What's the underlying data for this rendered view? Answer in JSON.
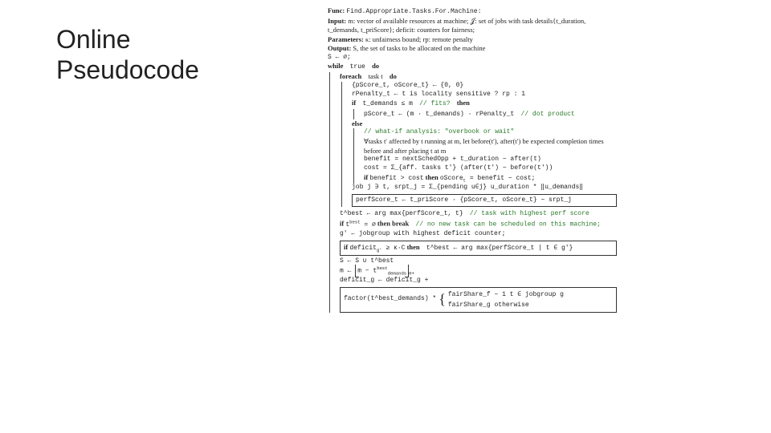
{
  "title_line1": "Online",
  "title_line2": "Pseudocode",
  "algo": {
    "func_label": "Func:",
    "func_name": "Find.Appropriate.Tasks.For.Machine:",
    "input_label": "Input:",
    "input_text": "m: vector of available resources at machine; 𝒥: set of jobs with task details{t_duration, t_demands, t_priScore}; deficit: counters for fairness;",
    "params_label": "Parameters:",
    "params_text": "κ: unfairness bound; rp: remote penalty",
    "output_label": "Output:",
    "output_text": "S, the set of tasks to be allocated on the machine",
    "l_init": "S ← ∅;",
    "l_while": "while",
    "l_while_cond": "true",
    "l_while_do": "do",
    "l_foreach": "foreach",
    "l_foreach_cond": "task t",
    "l_foreach_do": "do",
    "l_scores_init": "{pScore_t, oScore_t} ← {0, 0}",
    "l_rpenalty": "rPenalty_t ← t is locality sensitive ? rp : 1",
    "l_if": "if",
    "l_if_cond": "t_demands ≤ m",
    "l_if_comment": "// fits?",
    "l_then": "then",
    "l_pscore": "pScore_t ← (m · t_demands) · rPenalty_t",
    "l_pscore_comment": "// dot product",
    "l_else": "else",
    "l_else_comment": "// what-if analysis: \"overbook or wait\"",
    "l_forall_tasks": "∀tasks t′ affected by t running at m, let before(t′), after(t′) be expected completion times before and after placing t at m",
    "l_benefit": "benefit = nextSchedOpp + t_duration − after(t)",
    "l_cost": "cost = Σ_{aff. tasks t′} (after(t′) − before(t′))",
    "l_if_benefit": "if benefit > cost then oScore_t = benefit − cost;",
    "l_job_srpt": "job j ∋ t, srpt_j = Σ_{pending u∈j} u_duration * ‖u_demands‖",
    "l_perfscore": "perfScore_t ← t_priScore · {pScore_t, oScore_t} − srpt_j",
    "l_tbest": "t^best ← arg max{perfScore_t, t}",
    "l_tbest_comment": "// task with highest perf score",
    "l_if_empty": "if t^best = ∅ then break",
    "l_if_empty_comment": "// no new task can be scheduled on this machine;",
    "l_gprime": "g′ ← jobgroup with highest deficit counter;",
    "l_if_def_cond": "if deficit_{g′} ≥ κ·C then",
    "l_if_def_then": "t^best ← arg max{perfScore_t | t ∈ g′}",
    "l_update_S": "S ← S ∪ t^best",
    "l_update_m": "m ← ⌊ m − t^best_demands ⌋_{0+}",
    "l_update_def": "deficit_g ← deficit_g +",
    "l_factor_lhs": "factor(t^best_demands) *",
    "l_factor_top": "fairShare_f − 1    t ∈ jobgroup g",
    "l_factor_bot": "fairShare_g           otherwise"
  }
}
